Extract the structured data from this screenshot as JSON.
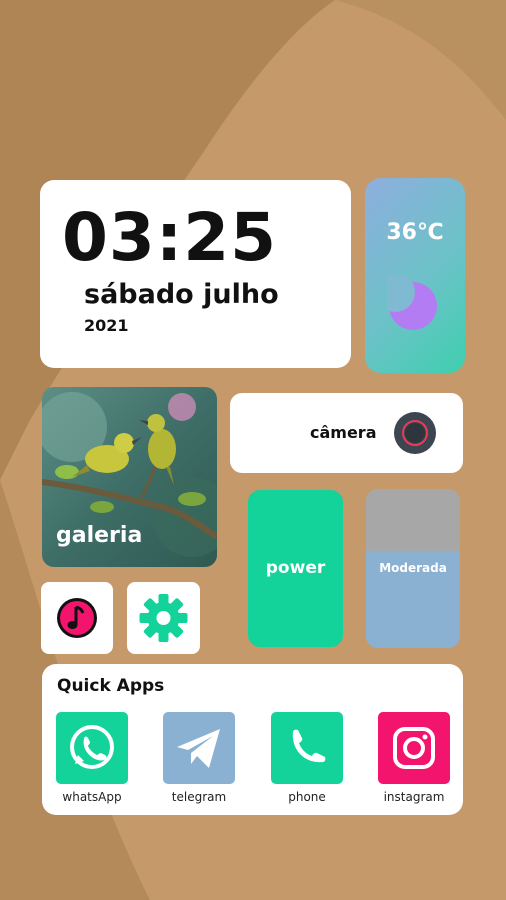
{
  "clock": {
    "time": "03:25",
    "date": "sábado julho",
    "year": "2021"
  },
  "weather": {
    "temperature": "36℃",
    "icon": "moon-icon"
  },
  "gallery": {
    "label": "galeria"
  },
  "camera": {
    "label": "câmera",
    "icon": "camera-lens-icon"
  },
  "music": {
    "icon": "music-note-icon"
  },
  "settings": {
    "icon": "gear-icon"
  },
  "power": {
    "label": "power"
  },
  "brightness": {
    "label": "Moderada"
  },
  "quick_apps": {
    "title": "Quick Apps",
    "apps": [
      {
        "name": "whatsApp",
        "icon": "whatsapp-icon",
        "color": "#13d29a"
      },
      {
        "name": "telegram",
        "icon": "telegram-icon",
        "color": "#8ab0d2"
      },
      {
        "name": "phone",
        "icon": "phone-icon",
        "color": "#13d29a"
      },
      {
        "name": "instagram",
        "icon": "instagram-icon",
        "color": "#f2146d"
      }
    ]
  },
  "colors": {
    "background": "#c6996a",
    "accent_green": "#13d29a",
    "accent_blue": "#8ab0d2",
    "accent_pink": "#f2146d",
    "moon": "#b47cf2"
  }
}
